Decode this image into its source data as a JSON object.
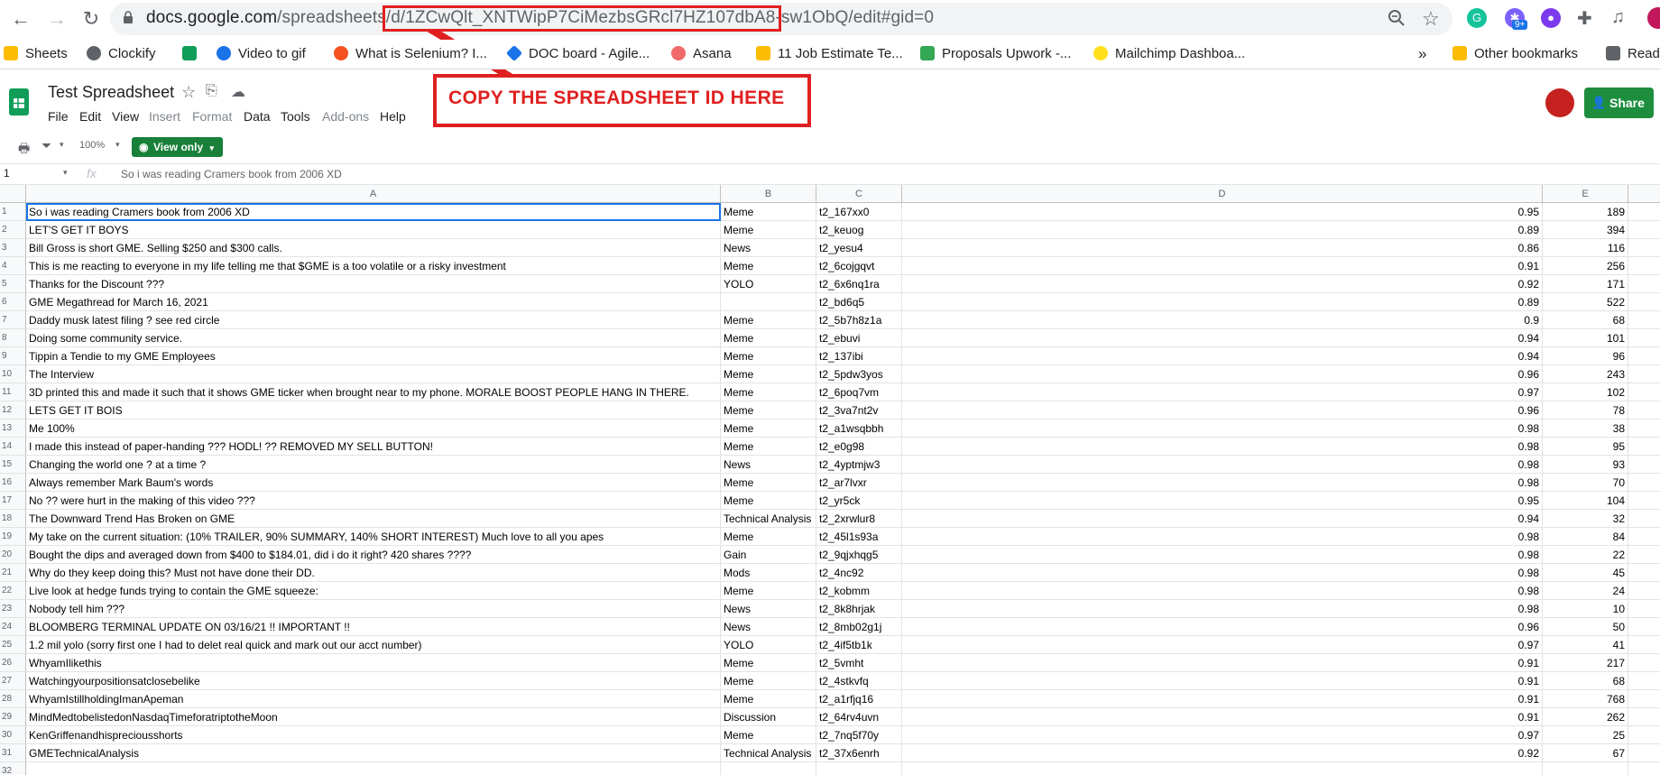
{
  "browser": {
    "url_host": "docs.google.com",
    "url_path": "/spreadsheets/d/1ZCwQlt_XNTWipP7CiMezbsGRcl7HZ107dbA8-sw1ObQ/edit#gid=0",
    "badge": "9+",
    "bookmarks": [
      {
        "label": "Sheets",
        "color": "#fbbc04"
      },
      {
        "label": "Clockify",
        "color": "#5f6368"
      },
      {
        "label": "",
        "color": "#0f9d58"
      },
      {
        "label": "Video to gif",
        "color": "#1a73e8"
      },
      {
        "label": "What is Selenium? I...",
        "color": "#f4511e"
      },
      {
        "label": "DOC board - Agile...",
        "color": "#1a73e8"
      },
      {
        "label": "Asana",
        "color": "#f06a6a"
      },
      {
        "label": "11 Job Estimate Te...",
        "color": "#fbbc04"
      },
      {
        "label": "Proposals Upwork -...",
        "color": "#34a853"
      },
      {
        "label": "Mailchimp Dashboa...",
        "color": "#ffe01b"
      }
    ],
    "overflow": "»",
    "other_bookmarks": "Other bookmarks",
    "reading": "Read"
  },
  "sheet": {
    "title": "Test Spreadsheet",
    "menus": [
      "File",
      "Edit",
      "View",
      "Insert",
      "Format",
      "Data",
      "Tools",
      "Add-ons",
      "Help"
    ],
    "share": "Share",
    "zoom": "100%",
    "view_only": "View only",
    "cell_ref": "1",
    "fx": "fx",
    "formula": "So i was reading Cramers book from 2006 XD",
    "col_headers": [
      "A",
      "B",
      "C",
      "D",
      "E"
    ]
  },
  "annotation": {
    "callout": "COPY THE SPREADSHEET ID HERE",
    "color": "#e02020"
  },
  "rows": [
    [
      "So i was reading Cramers book from 2006 XD",
      "Meme",
      "t2_167xx0",
      "0.95",
      "189"
    ],
    [
      "LET'S GET IT BOYS",
      "Meme",
      "t2_keuog",
      "0.89",
      "394"
    ],
    [
      "Bill Gross is short GME. Selling $250 and $300 calls.",
      "News",
      "t2_yesu4",
      "0.86",
      "116"
    ],
    [
      "This is me reacting to everyone in my life telling me that $GME is a too volatile or a risky investment",
      "Meme",
      "t2_6cojgqvt",
      "0.91",
      "256"
    ],
    [
      "Thanks for the Discount ???",
      "YOLO",
      "t2_6x6nq1ra",
      "0.92",
      "171"
    ],
    [
      "GME Megathread for March 16, 2021",
      "",
      "t2_bd6q5",
      "0.89",
      "522"
    ],
    [
      "Daddy musk latest filing ? see red circle",
      "Meme",
      "t2_5b7h8z1a",
      "0.9",
      "68"
    ],
    [
      "Doing some community service.",
      "Meme",
      "t2_ebuvi",
      "0.94",
      "101"
    ],
    [
      "Tippin a Tendie to my GME Employees",
      "Meme",
      "t2_137ibi",
      "0.94",
      "96"
    ],
    [
      "The Interview",
      "Meme",
      "t2_5pdw3yos",
      "0.96",
      "243"
    ],
    [
      "3D printed this and made it such that it shows GME ticker when brought near to my phone. MORALE BOOST PEOPLE HANG IN THERE.",
      "Meme",
      "t2_6poq7vm",
      "0.97",
      "102"
    ],
    [
      "LETS GET IT BOIS",
      "Meme",
      "t2_3va7nt2v",
      "0.96",
      "78"
    ],
    [
      "Me 100%",
      "Meme",
      "t2_a1wsqbbh",
      "0.98",
      "38"
    ],
    [
      "I made this instead of paper-handing ??? HODL! ?? REMOVED MY SELL BUTTON!",
      "Meme",
      "t2_e0g98",
      "0.98",
      "95"
    ],
    [
      "Changing the world one ? at a time ?",
      "News",
      "t2_4yptmjw3",
      "0.98",
      "93"
    ],
    [
      "Always remember Mark Baum's words",
      "Meme",
      "t2_ar7lvxr",
      "0.98",
      "70"
    ],
    [
      "No ?? were hurt in the making of this video ???",
      "Meme",
      "t2_yr5ck",
      "0.95",
      "104"
    ],
    [
      "The Downward Trend Has Broken on GME",
      "Technical Analysis",
      "t2_2xrwlur8",
      "0.94",
      "32"
    ],
    [
      "My take on the current situation: (10% TRAILER, 90% SUMMARY, 140% SHORT INTEREST) Much love to all you apes",
      "Meme",
      "t2_45l1s93a",
      "0.98",
      "84"
    ],
    [
      "Bought the dips and averaged down from $400 to $184.01, did i do it right? 420 shares ????",
      "Gain",
      "t2_9qjxhqg5",
      "0.98",
      "22"
    ],
    [
      "Why do they keep doing this? Must not have done their DD.",
      "Mods",
      "t2_4nc92",
      "0.98",
      "45"
    ],
    [
      "Live look at hedge funds trying to contain the GME squeeze:",
      "Meme",
      "t2_kobmm",
      "0.98",
      "24"
    ],
    [
      "Nobody tell him ???",
      "News",
      "t2_8k8hrjak",
      "0.98",
      "10"
    ],
    [
      "BLOOMBERG TERMINAL UPDATE ON 03/16/21 !! IMPORTANT !!",
      "News",
      "t2_8mb02g1j",
      "0.96",
      "50"
    ],
    [
      "1.2 mil yolo (sorry first one I had to delet real quick and mark out our acct number)",
      "YOLO",
      "t2_4if5tb1k",
      "0.97",
      "41"
    ],
    [
      "WhyamIlikethis",
      "Meme",
      "t2_5vmht",
      "0.91",
      "217"
    ],
    [
      "Watchingyourpositionsatclosebelike",
      "Meme",
      "t2_4stkvfq",
      "0.91",
      "68"
    ],
    [
      "WhyamIstillholdingImanApeman",
      "Meme",
      "t2_a1rfjq16",
      "0.91",
      "768"
    ],
    [
      "MindMedtobelistedonNasdaqTimeforatriptotheMoon",
      "Discussion",
      "t2_64rv4uvn",
      "0.91",
      "262"
    ],
    [
      "KenGriffenandhispreciousshorts",
      "Meme",
      "t2_7nq5f70y",
      "0.97",
      "25"
    ],
    [
      "GMETechnicalAnalysis",
      "Technical Analysis",
      "t2_37x6enrh",
      "0.92",
      "67"
    ]
  ],
  "next_row_number": "32"
}
